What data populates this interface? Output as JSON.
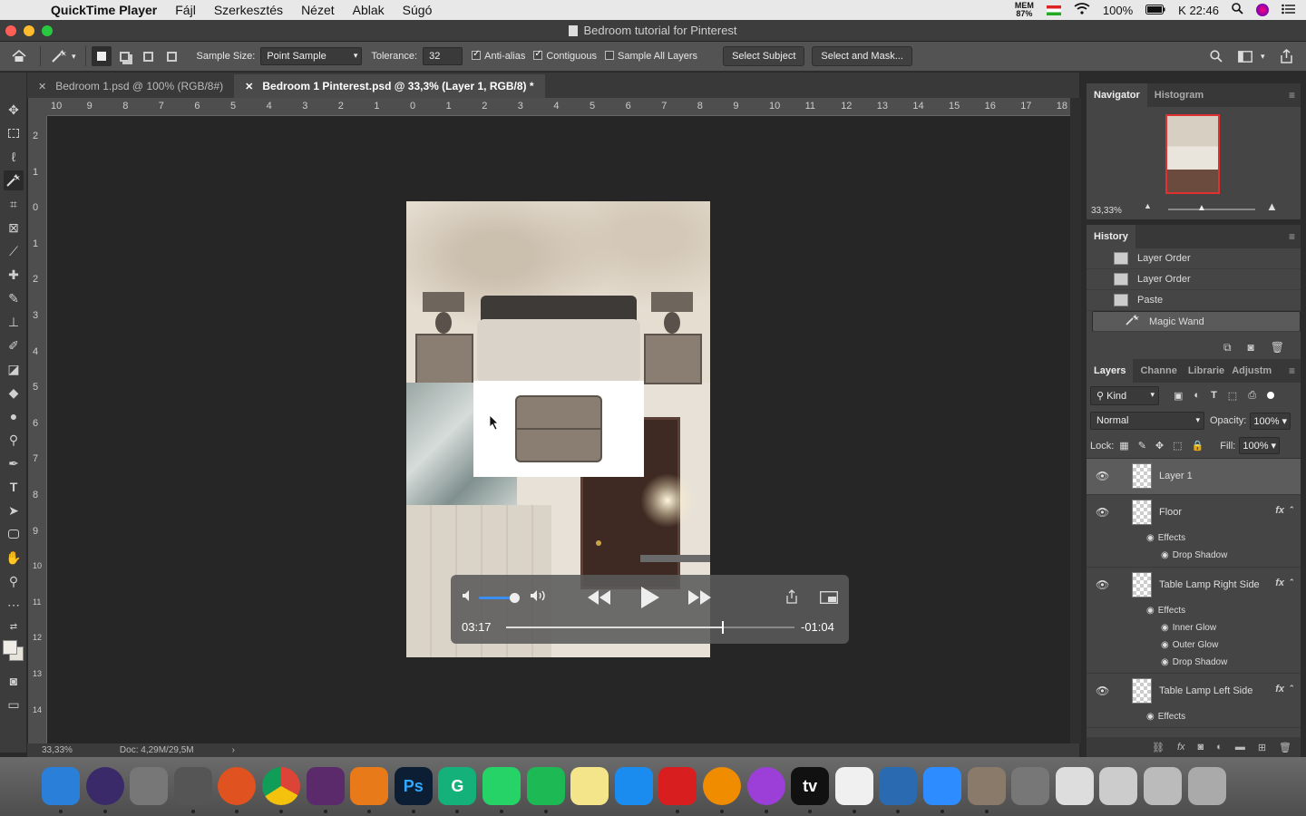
{
  "menubar": {
    "app_name": "QuickTime Player",
    "items": [
      "Fájl",
      "Szerkesztés",
      "Nézet",
      "Ablak",
      "Súgó"
    ],
    "mem_top": "MEM",
    "mem_value": "87%",
    "battery": "100%",
    "clock": "K 22:46"
  },
  "window": {
    "title": "Bedroom tutorial for Pinterest"
  },
  "options": {
    "sample_size_label": "Sample Size:",
    "sample_size_value": "Point Sample",
    "tolerance_label": "Tolerance:",
    "tolerance_value": "32",
    "anti_alias": "Anti-alias",
    "contiguous": "Contiguous",
    "sample_all_layers": "Sample All Layers",
    "select_subject": "Select Subject",
    "select_and_mask": "Select and Mask..."
  },
  "tabs": [
    {
      "label": "Bedroom 1.psd @ 100% (RGB/8#)"
    },
    {
      "label": "Bedroom 1 Pinterest.psd @ 33,3% (Layer 1, RGB/8) *"
    }
  ],
  "ruler_top": [
    "10",
    "9",
    "8",
    "7",
    "6",
    "5",
    "4",
    "3",
    "2",
    "1",
    "0",
    "1",
    "2",
    "3",
    "4",
    "5",
    "6",
    "7",
    "8",
    "9",
    "10",
    "11",
    "12",
    "13",
    "14",
    "15",
    "16",
    "17",
    "18"
  ],
  "ruler_left": [
    "2",
    "1",
    "0",
    "1",
    "2",
    "3",
    "4",
    "5",
    "6",
    "7",
    "8",
    "9",
    "10",
    "11",
    "12",
    "13",
    "14"
  ],
  "status": {
    "zoom": "33,33%",
    "doc": "Doc: 4,29M/29,5M"
  },
  "navigator": {
    "tab_navigator": "Navigator",
    "tab_histogram": "Histogram",
    "zoom": "33,33%"
  },
  "history": {
    "title": "History",
    "items": [
      "Layer Order",
      "Layer Order",
      "Paste",
      "Magic Wand"
    ]
  },
  "layers_panel": {
    "tabs": [
      "Layers",
      "Channe",
      "Librarie",
      "Adjustm"
    ],
    "kind": "Kind",
    "blend": "Normal",
    "opacity_label": "Opacity:",
    "opacity_value": "100%",
    "lock_label": "Lock:",
    "fill_label": "Fill:",
    "fill_value": "100%",
    "layers": [
      {
        "name": "Layer 1"
      },
      {
        "name": "Floor",
        "effects_label": "Effects",
        "effects": [
          "Drop Shadow"
        ]
      },
      {
        "name": "Table Lamp Right Side",
        "effects_label": "Effects",
        "effects": [
          "Inner Glow",
          "Outer Glow",
          "Drop Shadow"
        ]
      },
      {
        "name": "Table Lamp Left Side",
        "effects_label": "Effects"
      }
    ]
  },
  "video": {
    "elapsed": "03:17",
    "remaining": "-01:04",
    "volume": 0.85,
    "progress": 0.75
  },
  "dock": [
    {
      "name": "finder",
      "color": "#2a7fd8"
    },
    {
      "name": "siri",
      "color": "#3a2a6a"
    },
    {
      "name": "launchpad",
      "color": "#777"
    },
    {
      "name": "system-preferences",
      "color": "#555"
    },
    {
      "name": "brave",
      "color": "#e0521f"
    },
    {
      "name": "chrome",
      "color": "#e8e8e8"
    },
    {
      "name": "slack-business",
      "color": "#5a2a6a"
    },
    {
      "name": "blender",
      "color": "#e87a1a"
    },
    {
      "name": "photoshop",
      "label": "Ps",
      "color": "#0b1e34"
    },
    {
      "name": "grammarly",
      "label": "G",
      "color": "#14b27a"
    },
    {
      "name": "whatsapp",
      "color": "#25d366"
    },
    {
      "name": "spotify",
      "color": "#1db954"
    },
    {
      "name": "notes",
      "color": "#f4e48a"
    },
    {
      "name": "app-store",
      "color": "#1a8cf0"
    },
    {
      "name": "acrobat",
      "color": "#d81e1e"
    },
    {
      "name": "vlc",
      "color": "#f08c00"
    },
    {
      "name": "podcasts",
      "color": "#9b3fd8"
    },
    {
      "name": "apple-tv",
      "label": "tv",
      "color": "#111"
    },
    {
      "name": "music",
      "color": "#f0f0f0"
    },
    {
      "name": "quicktime",
      "color": "#2a6ab0"
    },
    {
      "name": "zoom",
      "color": "#2d8cff"
    },
    {
      "name": "downloads-stack",
      "color": "#8a7a6a"
    },
    {
      "name": "screenshot-stack",
      "color": "#777"
    },
    {
      "name": "documents-stack",
      "color": "#ddd"
    },
    {
      "name": "desktop-stack",
      "color": "#ccc"
    },
    {
      "name": "folder-stack",
      "color": "#bbb"
    },
    {
      "name": "trash",
      "color": "#aaa"
    }
  ]
}
